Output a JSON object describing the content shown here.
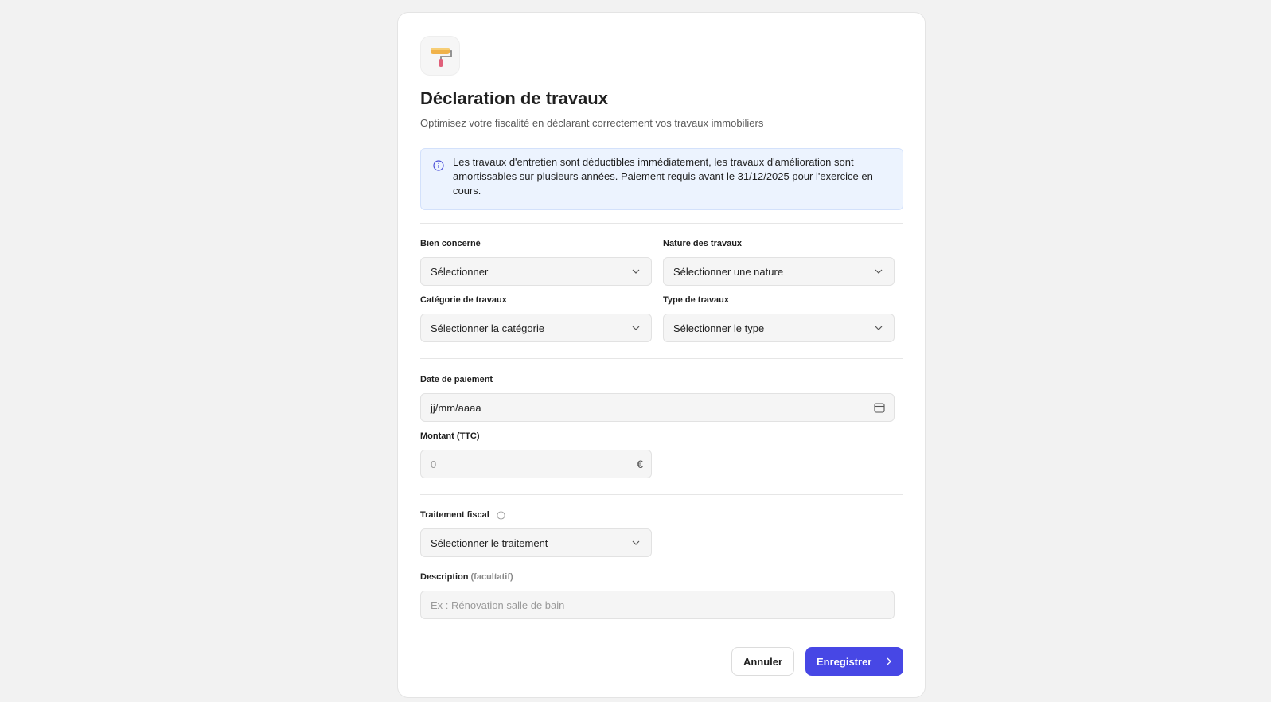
{
  "header": {
    "icon": "paint-roller-icon",
    "title": "Déclaration de travaux",
    "subtitle": "Optimisez votre fiscalité en déclarant correctement vos travaux immobiliers"
  },
  "info_banner": {
    "icon": "info-circle-icon",
    "text": "Les travaux d'entretien sont déductibles immédiatement, les travaux d'amélioration sont amortissables sur plusieurs années. Paiement requis avant le 31/12/2025 pour l'exercice en cours."
  },
  "fields": {
    "bien": {
      "label": "Bien concerné",
      "value": "Sélectionner"
    },
    "nature": {
      "label": "Nature des travaux",
      "value": "Sélectionner une nature"
    },
    "categorie": {
      "label": "Catégorie de travaux",
      "value": "Sélectionner la catégorie"
    },
    "type": {
      "label": "Type de travaux",
      "value": "Sélectionner le type"
    },
    "date": {
      "label": "Date de paiement",
      "value": "jj/mm/aaaa"
    },
    "montant": {
      "label": "Montant (TTC)",
      "placeholder": "0",
      "currency": "€"
    },
    "traitement": {
      "label": "Traitement fiscal",
      "value": "Sélectionner le traitement"
    },
    "description": {
      "label": "Description",
      "optional": "(facultatif)",
      "placeholder": "Ex : Rénovation salle de bain"
    }
  },
  "actions": {
    "cancel_label": "Annuler",
    "save_label": "Enregistrer"
  },
  "colors": {
    "primary": "#4747e5",
    "info_bg": "#ecf3fe",
    "page_bg": "#f2f2f2"
  }
}
